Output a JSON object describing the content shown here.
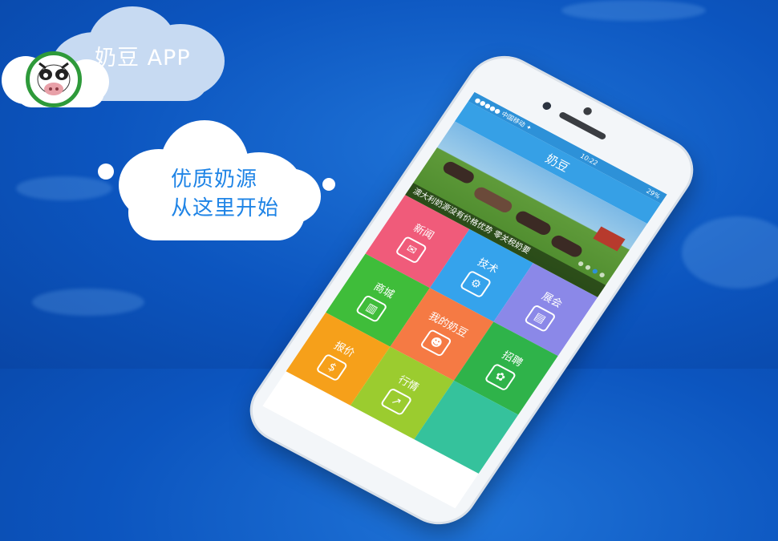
{
  "header": {
    "app_title": "奶豆 APP"
  },
  "slogan": {
    "line1": "优质奶源",
    "line2": "从这里开始"
  },
  "logo": {
    "icon": "cow-face-icon"
  },
  "phone": {
    "status": {
      "carrier": "●●●●● 中国移动 ✦",
      "time": "10:22",
      "battery": "29%"
    },
    "nav_title": "奶豆",
    "banner_caption": "澳大利奶源没有价格优势 零关税奶要",
    "tiles": [
      {
        "label": "新闻",
        "color": "#f05b7a",
        "icon": "news-icon",
        "glyph": "✉"
      },
      {
        "label": "技术",
        "color": "#35a3ec",
        "icon": "wrench-icon",
        "glyph": "⚙"
      },
      {
        "label": "展会",
        "color": "#8b88e8",
        "icon": "booth-icon",
        "glyph": "▤"
      },
      {
        "label": "商城",
        "color": "#3fbd3a",
        "icon": "store-icon",
        "glyph": "▥"
      },
      {
        "label": "我的奶豆",
        "color": "#f57a44",
        "icon": "user-card-icon",
        "glyph": "☻"
      },
      {
        "label": "招聘",
        "color": "#2fb34a",
        "icon": "handshake-icon",
        "glyph": "✿"
      },
      {
        "label": "报价",
        "color": "#f6a01a",
        "icon": "money-bag-icon",
        "glyph": "$"
      },
      {
        "label": "行情",
        "color": "#9bcc2f",
        "icon": "trend-icon",
        "glyph": "↗"
      },
      {
        "label": "",
        "color": "#35c29c",
        "icon": "more-icon",
        "glyph": ""
      }
    ]
  },
  "colors": {
    "background": "#0c55bf",
    "accent": "#36a0e6"
  }
}
